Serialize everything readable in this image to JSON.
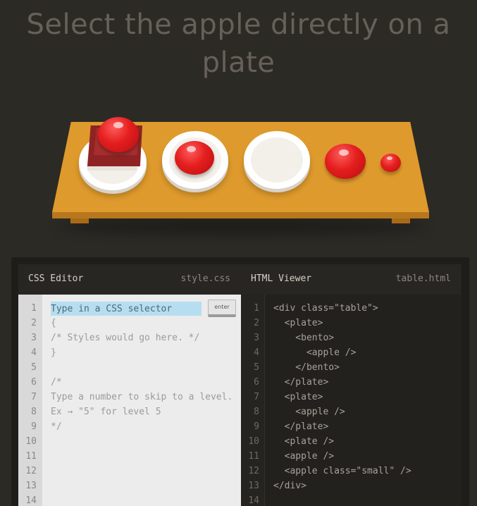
{
  "instruction": {
    "line1": "Select the apple directly on a",
    "line2": "plate"
  },
  "table": {
    "items": [
      "bento-with-apple-on-plate",
      "apple-on-plate",
      "empty-plate",
      "apple",
      "small-apple"
    ]
  },
  "css_editor": {
    "title": "CSS Editor",
    "filename": "style.css",
    "input_placeholder": "Type in a CSS selector",
    "enter_label": "enter",
    "line_numbers": [
      "1",
      "2",
      "3",
      "4",
      "5",
      "6",
      "7",
      "8",
      "9",
      "10",
      "11",
      "12",
      "13",
      "14"
    ],
    "lines": [
      "",
      "{",
      "/* Styles would go here. */",
      "}",
      "",
      "/*",
      "Type a number to skip to a level.",
      "Ex → \"5\" for level 5",
      "*/"
    ]
  },
  "html_viewer": {
    "title": "HTML Viewer",
    "filename": "table.html",
    "line_numbers": [
      "1",
      "2",
      "3",
      "4",
      "5",
      "6",
      "7",
      "8",
      "9",
      "10",
      "11",
      "12",
      "13",
      "14"
    ],
    "lines": [
      "<div class=\"table\">",
      "  <plate>",
      "    <bento>",
      "      <apple />",
      "    </bento>",
      "  </plate>",
      "  <plate>",
      "    <apple />",
      "  </plate>",
      "  <plate />",
      "  <apple />",
      "  <apple class=\"small\" />",
      "</div>"
    ]
  },
  "colors": {
    "background": "#2c2a25",
    "table": "#de9a2c",
    "apple": "#e41e1e",
    "bento": "#8f2323",
    "input_highlight": "#b6def0"
  }
}
